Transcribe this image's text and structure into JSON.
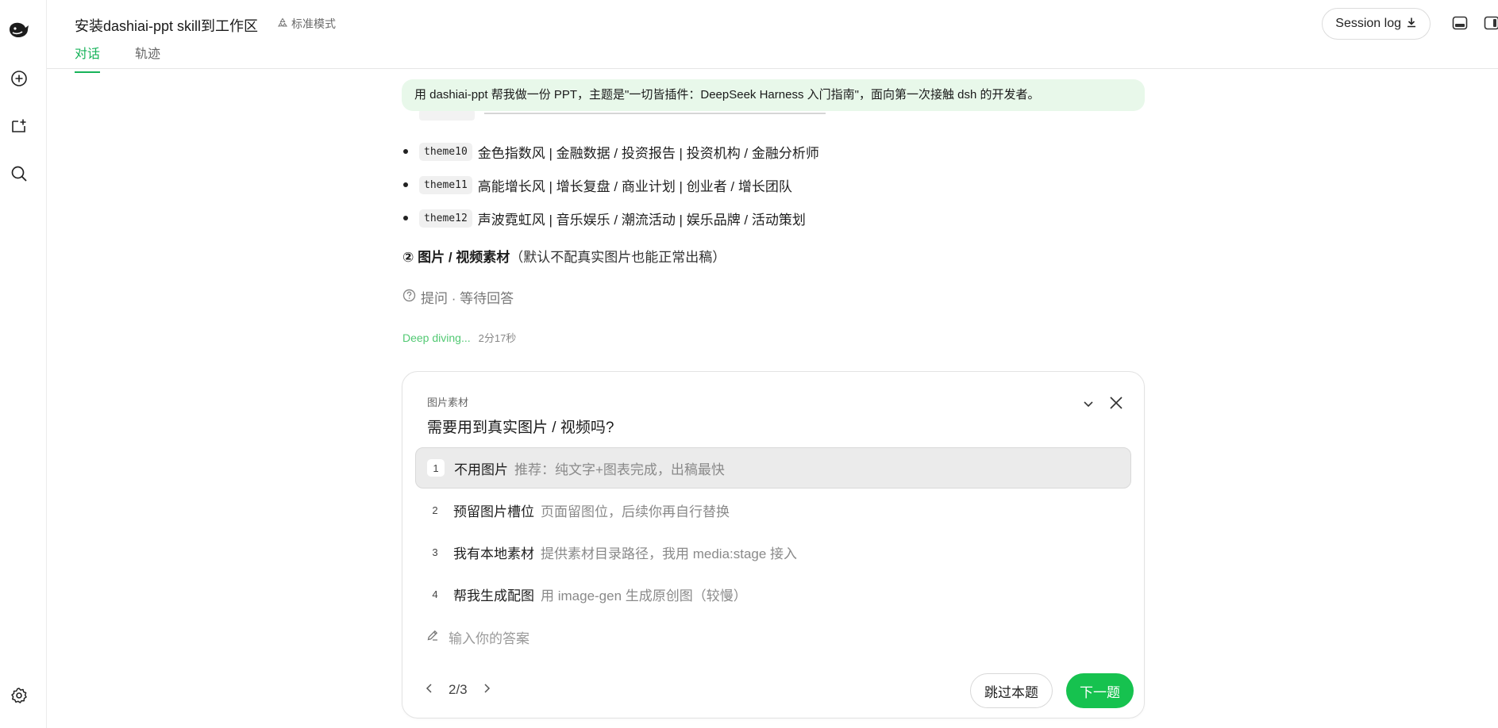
{
  "sidebar": {
    "icons": [
      "deepseek-logo-icon",
      "new-chat-icon",
      "new-project-icon",
      "search-icon",
      "settings-icon"
    ]
  },
  "header": {
    "title": "安装dashiai-ppt skill到工作区",
    "mode_label": "标准模式",
    "tabs": [
      {
        "label": "对话",
        "active": true
      },
      {
        "label": "轨迹",
        "active": false
      }
    ],
    "session_log_label": "Session log",
    "accent_color": "#17b35a"
  },
  "conversation": {
    "user_prompt": "用 dashiai-ppt 帮我做一份 PPT，主题是\"一切皆插件：DeepSeek Harness 入门指南\"，面向第一次接触 dsh 的开发者。",
    "themes": [
      {
        "code": "theme10",
        "text": "金色指数风 | 金融数据 / 投资报告 | 投资机构 / 金融分析师"
      },
      {
        "code": "theme11",
        "text": "高能增长风 | 增长复盘 / 商业计划 | 创业者 / 增长团队"
      },
      {
        "code": "theme12",
        "text": "声波霓虹风 | 音乐娱乐 / 潮流活动 | 娱乐品牌 / 活动策划"
      }
    ],
    "section_heading": "② 图片 / 视频素材",
    "section_note": "（默认不配真实图片也能正常出稿）",
    "ask_label": "提问 · 等待回答",
    "status_label": "Deep diving...",
    "status_time": "2分17秒"
  },
  "question_card": {
    "kicker": "图片素材",
    "question": "需要用到真实图片 / 视频吗?",
    "options": [
      {
        "num": "1",
        "label": "不用图片",
        "desc": "推荐：纯文字+图表完成，出稿最快",
        "selected": true
      },
      {
        "num": "2",
        "label": "预留图片槽位",
        "desc": "页面留图位，后续你再自行替换",
        "selected": false
      },
      {
        "num": "3",
        "label": "我有本地素材",
        "desc": "提供素材目录路径，我用 media:stage 接入",
        "selected": false
      },
      {
        "num": "4",
        "label": "帮我生成配图",
        "desc": "用 image-gen 生成原创图（较慢）",
        "selected": false
      }
    ],
    "answer_placeholder": "输入你的答案",
    "pager": "2/3",
    "skip_label": "跳过本题",
    "next_label": "下一题",
    "next_color": "#16c24f"
  }
}
